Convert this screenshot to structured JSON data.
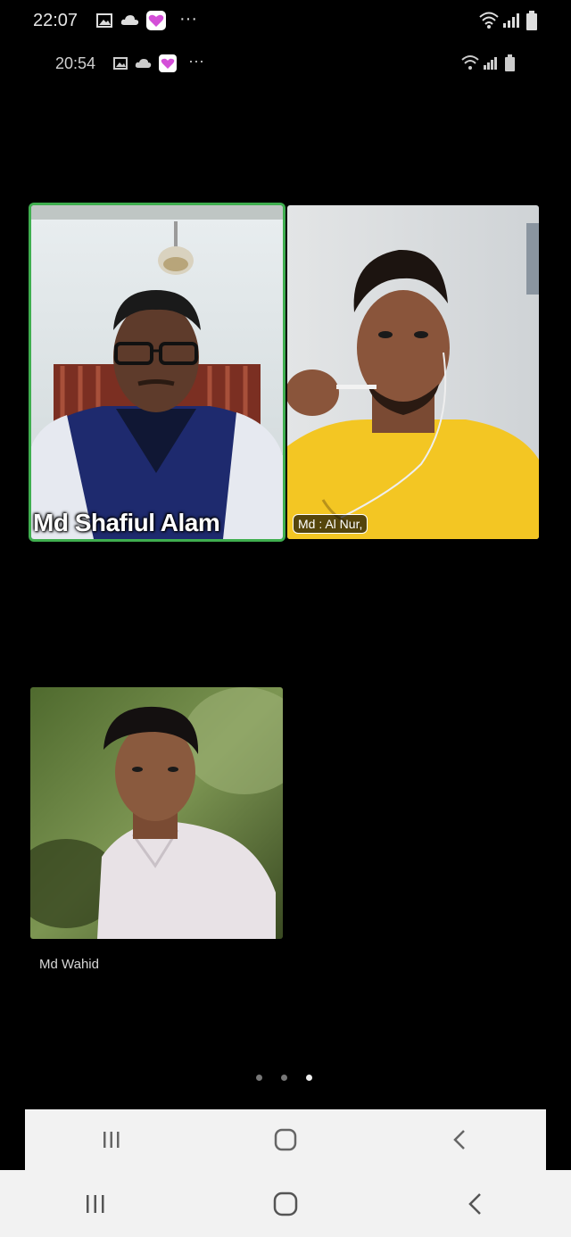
{
  "status_bar_outer": {
    "time": "22:07",
    "more": "···",
    "icons": [
      "gallery-icon",
      "cloud-icon",
      "heart-app-icon",
      "wifi-icon",
      "signal-icon",
      "battery-icon"
    ]
  },
  "status_bar_inner": {
    "time": "20:54",
    "more": "···",
    "icons": [
      "gallery-icon",
      "cloud-icon",
      "heart-app-icon",
      "wifi-icon",
      "signal-icon",
      "battery-icon"
    ]
  },
  "participants": [
    {
      "name": "Md Shafiul Alam",
      "speaking": true
    },
    {
      "name": "Md : Al Nur,",
      "speaking": false
    },
    {
      "name": "Md Wahid",
      "speaking": false
    }
  ],
  "page_indicator": {
    "pages": 3,
    "current": 3
  },
  "colors": {
    "background": "#000000",
    "active_speaker_border": "#3fae4f",
    "inner_navbar": "#f2f2f2",
    "outer_navbar": "#f2f2f2"
  },
  "nav_buttons": [
    "recent-apps-icon",
    "home-icon",
    "back-icon"
  ]
}
